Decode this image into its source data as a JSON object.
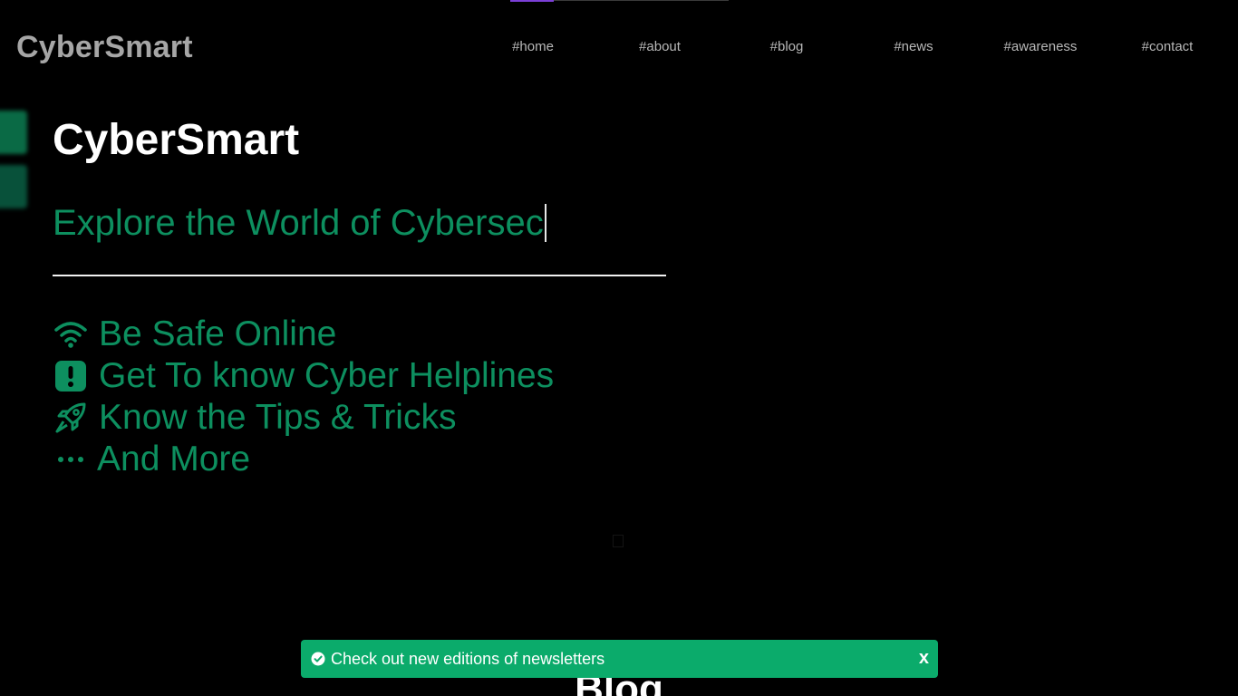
{
  "app": {
    "logo": "CyberSmart"
  },
  "nav": {
    "items": [
      {
        "label": "#home"
      },
      {
        "label": "#about"
      },
      {
        "label": "#blog"
      },
      {
        "label": "#news"
      },
      {
        "label": "#awareness"
      },
      {
        "label": "#contact"
      }
    ]
  },
  "hero": {
    "title": "CyberSmart",
    "typed_text": "Explore the World of Cybersec",
    "features": [
      {
        "icon": "wifi-icon",
        "label": "Be Safe Online"
      },
      {
        "icon": "alert-square-icon",
        "label": "Get To know Cyber Helplines"
      },
      {
        "icon": "rocket-icon",
        "label": "Know the Tips & Tricks"
      },
      {
        "icon": "dots-icon",
        "label": "And More"
      }
    ]
  },
  "sections": {
    "blog_heading": "Blog"
  },
  "toast": {
    "message": "Check out new editions of newsletters",
    "close_label": "x"
  },
  "scroll_progress": 0.2,
  "colors": {
    "background": "#000000",
    "accent_green": "#0d8f5f",
    "toast_green": "#0bab6b",
    "progress_purple": "#7b3fd6",
    "logo_gray": "#a6a6a6"
  }
}
